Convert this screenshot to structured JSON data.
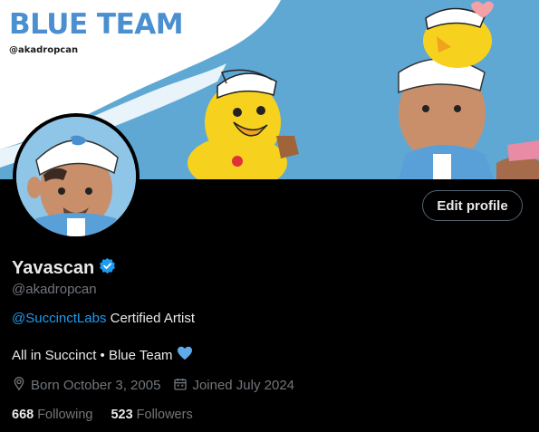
{
  "banner": {
    "title": "BLUE TEAM",
    "handle": "@akadropcan"
  },
  "profile": {
    "name": "Yavascan",
    "handle": "@akadropcan",
    "edit_label": "Edit profile",
    "bio_mention": "@SuccinctLabs",
    "bio_line1_rest": " Certified Artist",
    "bio_line2": "All in Succinct • Blue Team",
    "born": "Born October 3, 2005",
    "joined": "Joined July 2024",
    "following_count": "668",
    "following_label": "Following",
    "followers_count": "523",
    "followers_label": "Followers"
  },
  "icons": {
    "verified": "verified-badge-icon",
    "heart": "blue-heart-icon",
    "location": "location-pin-icon",
    "calendar": "calendar-icon"
  },
  "colors": {
    "accent": "#1d9bf0",
    "muted": "#71767b",
    "text": "#e7e9ea",
    "background": "#000000",
    "banner_blue": "#5fa8d3"
  }
}
